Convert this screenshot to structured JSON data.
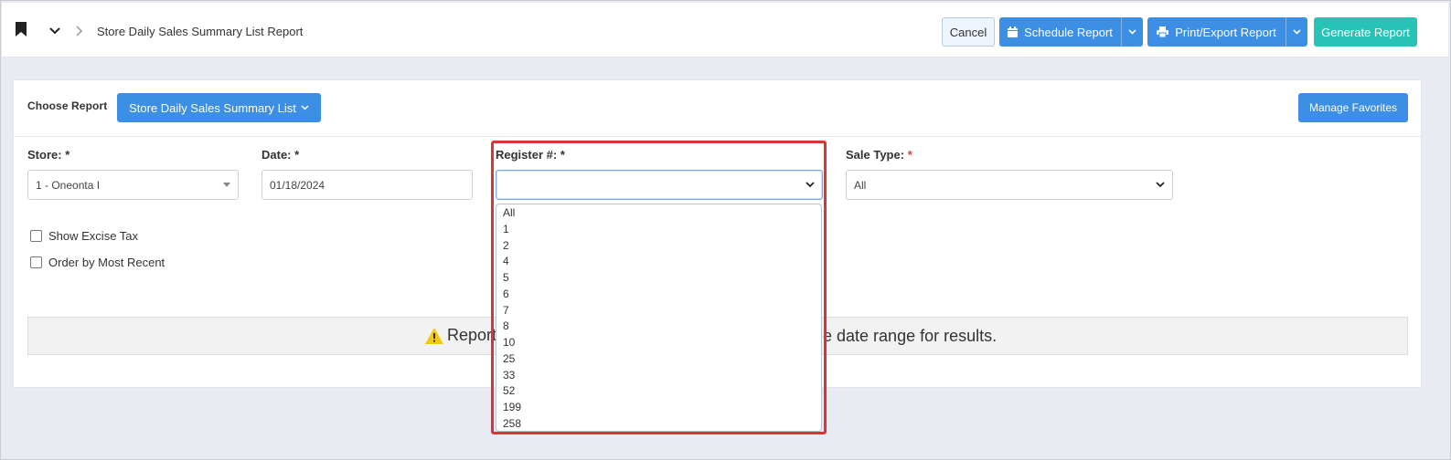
{
  "header": {
    "breadcrumb": "Store Daily Sales Summary List Report",
    "cancel_label": "Cancel",
    "schedule_label": "Schedule Report",
    "print_label": "Print/Export Report",
    "generate_label": "Generate Report"
  },
  "chooser": {
    "label": "Choose Report",
    "selected": "Store Daily Sales Summary List",
    "manage_label": "Manage Favorites"
  },
  "fields": {
    "store": {
      "label": "Store:",
      "req": "*",
      "value": "1 - Oneonta I"
    },
    "date": {
      "label": "Date:",
      "req": "*",
      "value": "01/18/2024"
    },
    "register": {
      "label": "Register #:",
      "req": "*",
      "value": ""
    },
    "sale_type": {
      "label": "Sale Type:",
      "req": "*",
      "value": "All"
    }
  },
  "options": {
    "show_excise": "Show Excise Tax",
    "order_recent": "Order by Most Recent"
  },
  "notice": {
    "left": "Report",
    "right": "he date range for results."
  },
  "register_options": [
    "All",
    "1",
    "2",
    "4",
    "5",
    "6",
    "7",
    "8",
    "10",
    "25",
    "33",
    "52",
    "199",
    "258"
  ],
  "colors": {
    "primary": "#3d8fe5",
    "teal": "#27c3b6",
    "highlight": "#e03232",
    "warning": "#f2c811"
  }
}
